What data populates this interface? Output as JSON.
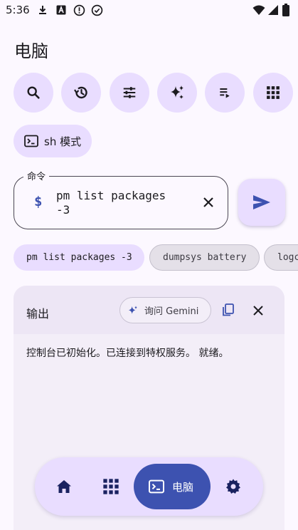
{
  "status_bar": {
    "time": "5:36",
    "left_icons": [
      "download-icon",
      "text-a-icon",
      "alert-icon",
      "check-circle-icon"
    ],
    "right_icons": [
      "wifi-icon",
      "signal-icon",
      "battery-icon"
    ]
  },
  "page": {
    "title": "电脑"
  },
  "toolbar": {
    "buttons": [
      "search-icon",
      "history-icon",
      "tune-icon",
      "sparkle-icon",
      "playlist-icon",
      "grid-icon"
    ]
  },
  "mode_chip": {
    "label": "sh 模式"
  },
  "command": {
    "label": "命令",
    "prompt": "$",
    "value": "pm list packages\n-3"
  },
  "history": {
    "chips": [
      "pm list packages -3",
      "dumpsys battery",
      "logc"
    ]
  },
  "output": {
    "title": "输出",
    "gemini_label": "询问 Gemini",
    "text": "控制台已初始化。已连接到特权服务。 就绪。"
  },
  "bottom_nav": {
    "active_label": "电脑",
    "items": [
      "home-icon",
      "apps-icon",
      "terminal-icon",
      "settings-icon"
    ]
  },
  "colors": {
    "background": "#FCF8FF",
    "chip": "#E9DDFF",
    "accent": "#3D52B0",
    "card": "#F3EEF8"
  }
}
